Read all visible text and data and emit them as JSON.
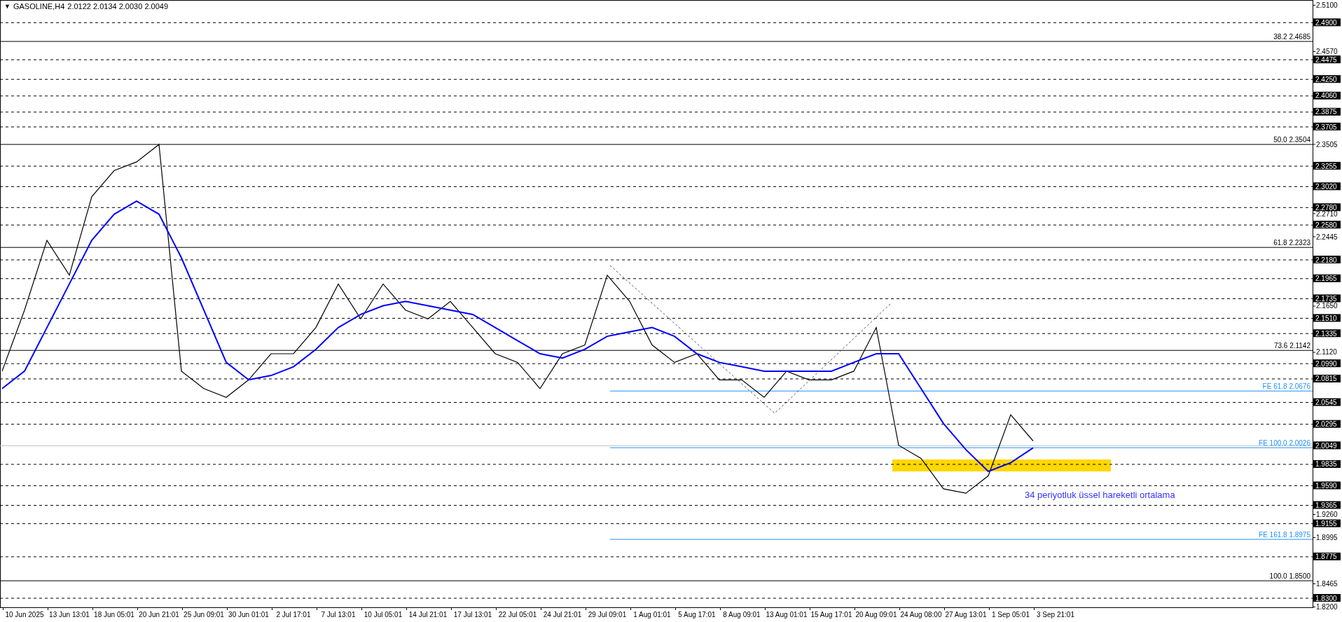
{
  "header": {
    "glyph": "▼",
    "title": "GASOLINE,H4",
    "quote": "2.0122 2.0134 2.0030 2.0049"
  },
  "chart_data": {
    "type": "line",
    "ylim": [
      1.8192,
      2.5156
    ],
    "categories": [
      null,
      "10 Jun 2025",
      null,
      "13 Jun 13:01",
      null,
      "18 Jun 05:01",
      null,
      "20 Jun 21:01",
      null,
      "25 Jun 09:01",
      null,
      "30 Jun 01:01",
      null,
      "2 Jul 17:01",
      null,
      "7 Jul 13:01",
      null,
      "10 Jul 05:01",
      null,
      "14 Jul 21:01",
      null,
      "17 Jul 13:01",
      null,
      "22 Jul 05:01",
      null,
      "24 Jul 21:01",
      null,
      "29 Jul 09:01",
      null,
      "1 Aug 01:01",
      null,
      "5 Aug 17:01",
      null,
      "8 Aug 09:01",
      null,
      "13 Aug 01:01",
      null,
      "15 Aug 17:01",
      null,
      "20 Aug 09:01",
      null,
      "24 Aug 08:00",
      null,
      "27 Aug 13:01",
      null,
      "1 Sep 05:01",
      null,
      "3 Sep 21:01"
    ],
    "yticks": [
      {
        "value": 2.51,
        "label": "2.5100"
      },
      {
        "value": 2.49,
        "label": "2.4900"
      },
      {
        "value": 2.457,
        "label": "2.4570"
      },
      {
        "value": 2.4475,
        "label": "2.4475"
      },
      {
        "value": 2.425,
        "label": "2.4250"
      },
      {
        "value": 2.406,
        "label": "2.4060"
      },
      {
        "value": 2.3875,
        "label": "2.3875"
      },
      {
        "value": 2.3705,
        "label": "2.3705"
      },
      {
        "value": 2.3505,
        "label": "2.3505"
      },
      {
        "value": 2.3255,
        "label": "2.3255"
      },
      {
        "value": 2.302,
        "label": "2.3020"
      },
      {
        "value": 2.278,
        "label": "2.2780"
      },
      {
        "value": 2.271,
        "label": "2.2710"
      },
      {
        "value": 2.258,
        "label": "2.2580"
      },
      {
        "value": 2.2445,
        "label": "2.2445"
      },
      {
        "value": 2.218,
        "label": "2.2180"
      },
      {
        "value": 2.1965,
        "label": "2.1965"
      },
      {
        "value": 2.1735,
        "label": "2.1735"
      },
      {
        "value": 2.165,
        "label": "2.1650"
      },
      {
        "value": 2.151,
        "label": "2.1510"
      },
      {
        "value": 2.1335,
        "label": "2.1335"
      },
      {
        "value": 2.112,
        "label": "2.1120"
      },
      {
        "value": 2.099,
        "label": "2.0990"
      },
      {
        "value": 2.0815,
        "label": "2.0815"
      },
      {
        "value": 2.0545,
        "label": "2.0545"
      },
      {
        "value": 2.0295,
        "label": "2.0295"
      },
      {
        "value": 2.0049,
        "label": "2.0049"
      },
      {
        "value": 1.9835,
        "label": "1.9835"
      },
      {
        "value": 1.959,
        "label": "1.9590"
      },
      {
        "value": 1.9365,
        "label": "1.9365"
      },
      {
        "value": 1.926,
        "label": "1.9260"
      },
      {
        "value": 1.9155,
        "label": "1.9155"
      },
      {
        "value": 1.8995,
        "label": "1.8995"
      },
      {
        "value": 1.8775,
        "label": "1.8775"
      },
      {
        "value": 1.8465,
        "label": "1.8465"
      },
      {
        "value": 1.83,
        "label": "1.8300"
      },
      {
        "value": 1.82,
        "label": "1.8200"
      }
    ],
    "series": [
      {
        "color": "#000000",
        "values": [
          2.09,
          2.16,
          2.24,
          2.2,
          2.29,
          2.32,
          2.33,
          2.35,
          2.09,
          2.07,
          2.06,
          2.08,
          2.11,
          2.11,
          2.14,
          2.19,
          2.15,
          2.19,
          2.16,
          2.15,
          2.17,
          2.14,
          2.11,
          2.1,
          2.07,
          2.11,
          2.12,
          2.2,
          2.17,
          2.12,
          2.1,
          2.11,
          2.08,
          2.08,
          2.06,
          2.09,
          2.08,
          2.08,
          2.09,
          2.14,
          2.005,
          1.99,
          1.955,
          1.95,
          1.97,
          2.04,
          2.01,
          null
        ]
      },
      {
        "color": "#0000ff",
        "values": [
          2.07,
          2.09,
          2.14,
          2.19,
          2.24,
          2.27,
          2.285,
          2.27,
          2.22,
          2.16,
          2.1,
          2.08,
          2.085,
          2.095,
          2.115,
          2.14,
          2.155,
          2.165,
          2.17,
          2.165,
          2.16,
          2.155,
          2.14,
          2.125,
          2.11,
          2.105,
          2.115,
          2.13,
          2.135,
          2.14,
          2.13,
          2.11,
          2.1,
          2.095,
          2.09,
          2.09,
          2.09,
          2.09,
          2.1,
          2.11,
          2.11,
          2.07,
          2.03,
          2.0,
          1.975,
          1.985,
          2.002,
          null
        ]
      }
    ],
    "bands": [
      {
        "axis": "y",
        "from": 1.975,
        "to": 1.9887,
        "color": "#ffd700"
      }
    ],
    "ref_lines": [
      {
        "axis": "y",
        "value": 2.49
      },
      {
        "axis": "y",
        "value": 2.4685,
        "label": "38.2 2.4685"
      },
      {
        "axis": "y",
        "value": 2.4475
      },
      {
        "axis": "y",
        "value": 2.425
      },
      {
        "axis": "y",
        "value": 2.406
      },
      {
        "axis": "y",
        "value": 2.3875
      },
      {
        "axis": "y",
        "value": 2.3705
      },
      {
        "axis": "y",
        "value": 2.3504,
        "label": "50.0 2.3504"
      },
      {
        "axis": "y",
        "value": 2.3255
      },
      {
        "axis": "y",
        "value": 2.302
      },
      {
        "axis": "y",
        "value": 2.278
      },
      {
        "axis": "y",
        "value": 2.258
      },
      {
        "axis": "y",
        "value": 2.2323,
        "label": "61.8 2.2323"
      },
      {
        "axis": "y",
        "value": 2.218
      },
      {
        "axis": "y",
        "value": 2.1965
      },
      {
        "axis": "y",
        "value": 2.1735
      },
      {
        "axis": "y",
        "value": 2.151
      },
      {
        "axis": "y",
        "value": 2.1335
      },
      {
        "axis": "y",
        "value": 2.1142,
        "label": "73.6 2.1142"
      },
      {
        "axis": "y",
        "value": 2.099
      },
      {
        "axis": "y",
        "value": 2.0815
      },
      {
        "axis": "y",
        "value": 2.0676,
        "label": "FE 61.8 2.0676",
        "color": "#1e90ff"
      },
      {
        "axis": "y",
        "value": 2.0545
      },
      {
        "axis": "y",
        "value": 2.0295
      },
      {
        "axis": "y",
        "value": 2.0049,
        "color": "#c0c0c0"
      },
      {
        "axis": "y",
        "value": 2.0026,
        "label": "FE 100.0 2.0026",
        "color": "#1e90ff"
      },
      {
        "axis": "y",
        "value": 1.9835
      },
      {
        "axis": "y",
        "value": 1.959
      },
      {
        "axis": "y",
        "value": 1.9365
      },
      {
        "axis": "y",
        "value": 1.9155
      },
      {
        "axis": "y",
        "value": 1.8975,
        "label": "FE 161.8 1.8975",
        "color": "#1e90ff"
      },
      {
        "axis": "y",
        "value": 1.8775
      },
      {
        "axis": "y",
        "value": 1.85,
        "label": "100.0 1.8500"
      },
      {
        "axis": "y",
        "value": 1.83
      }
    ],
    "annotations": [
      "34 periyotluk üssel hareketli ortalama"
    ]
  }
}
